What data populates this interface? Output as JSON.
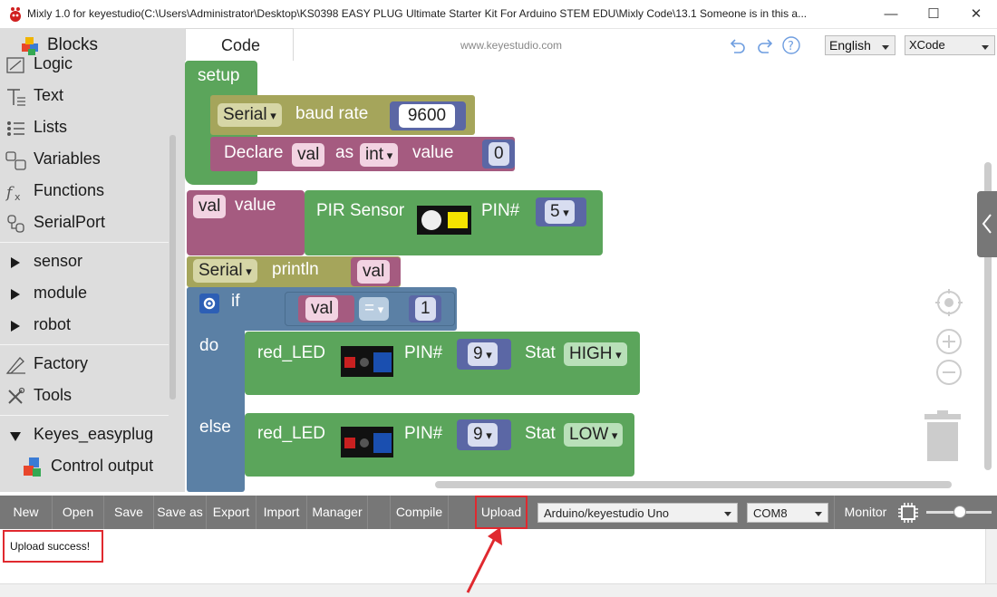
{
  "window": {
    "title": "Mixly 1.0 for keyestudio(C:\\Users\\Administrator\\Desktop\\KS0398 EASY PLUG Ultimate Starter Kit For Arduino STEM EDU\\Mixly Code\\13.1 Someone is in this a...",
    "minimize": "—",
    "maximize": "☐",
    "close": "✕"
  },
  "tabs": {
    "blocks": "Blocks",
    "code": "Code"
  },
  "site": "www.keyestudio.com",
  "language": "English",
  "theme": "XCode",
  "sidebar": {
    "categories": [
      "Logic",
      "Text",
      "Lists",
      "Variables",
      "Functions",
      "SerialPort"
    ],
    "groups": [
      "sensor",
      "module",
      "robot"
    ],
    "tools": [
      "Factory",
      "Tools"
    ],
    "expanded_group": "Keyes_easyplug",
    "sub_item": "Control output"
  },
  "blocks": {
    "setup": "setup",
    "serial": "Serial",
    "baud_rate": "baud rate",
    "baud_value": "9600",
    "declare": "Declare",
    "var": "val",
    "as": "as",
    "type": "int",
    "value": "value",
    "init": "0",
    "pir": "PIR Sensor",
    "pin": "PIN#",
    "pir_pin": "5",
    "println": "println",
    "if": "if",
    "eq": "=",
    "cmp": "1",
    "do": "do",
    "else": "else",
    "led": "red_LED",
    "led_pin": "9",
    "stat": "Stat",
    "high": "HIGH",
    "low": "LOW"
  },
  "toolbar": {
    "buttons": [
      "New",
      "Open",
      "Save",
      "Save as",
      "Export",
      "Import",
      "Manager",
      "Compile",
      "Upload"
    ],
    "board": "Arduino/keyestudio Uno",
    "port": "COM8",
    "monitor": "Monitor"
  },
  "console": {
    "message": "Upload success!"
  },
  "colors": {
    "procedure": "#5ba55b",
    "serial": "#a5a55b",
    "variable": "#a55b80",
    "number": "#5b67a5",
    "logic": "#5b80a5",
    "highlight": "#e0292f"
  }
}
